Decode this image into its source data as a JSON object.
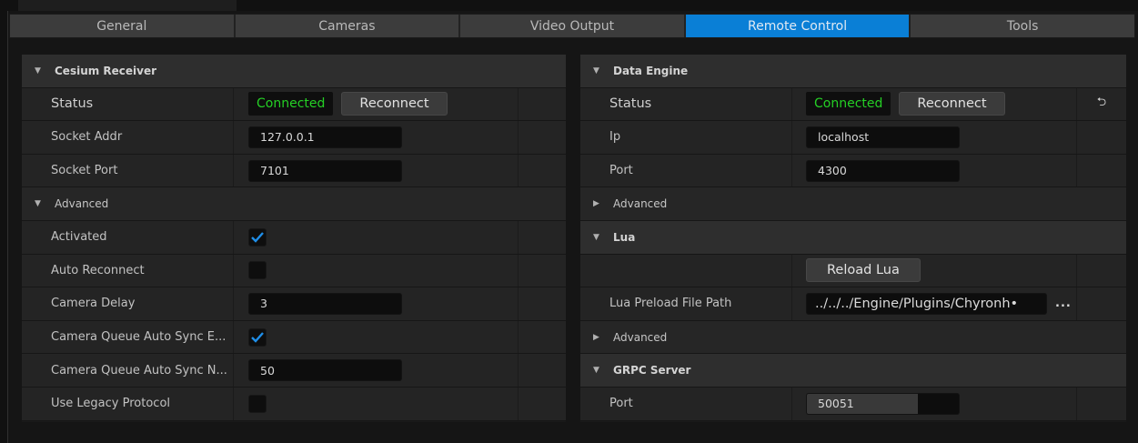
{
  "tabs": [
    {
      "label": "General",
      "active": false
    },
    {
      "label": "Cameras",
      "active": false
    },
    {
      "label": "Video Output",
      "active": false
    },
    {
      "label": "Remote Control",
      "active": true
    },
    {
      "label": "Tools",
      "active": false
    }
  ],
  "left": {
    "cesium_header": "Cesium Receiver",
    "status_label": "Status",
    "status_value": "Connected",
    "reconnect_label": "Reconnect",
    "socket_addr_label": "Socket Addr",
    "socket_addr_value": "127.0.0.1",
    "socket_port_label": "Socket Port",
    "socket_port_value": "7101",
    "advanced_label": "Advanced",
    "activated_label": "Activated",
    "activated_checked": true,
    "auto_reconnect_label": "Auto Reconnect",
    "auto_reconnect_checked": false,
    "camera_delay_label": "Camera Delay",
    "camera_delay_value": "3",
    "queue_sync_e_label": "Camera Queue Auto Sync E...",
    "queue_sync_e_checked": true,
    "queue_sync_n_label": "Camera Queue Auto Sync N...",
    "queue_sync_n_value": "50",
    "legacy_label": "Use Legacy Protocol",
    "legacy_checked": false
  },
  "right": {
    "data_engine_header": "Data Engine",
    "status_label": "Status",
    "status_value": "Connected",
    "reconnect_label": "Reconnect",
    "ip_label": "Ip",
    "ip_value": "localhost",
    "port_label": "Port",
    "port_value": "4300",
    "advanced_label": "Advanced",
    "lua_header": "Lua",
    "reload_lua_label": "Reload Lua",
    "lua_path_label": "Lua Preload File Path",
    "lua_path_value": "../../../Engine/Plugins/Chyronh•",
    "ellipsis_label": "...",
    "advanced2_label": "Advanced",
    "grpc_header": "GRPC Server",
    "grpc_port_label": "Port",
    "grpc_port_value": "50051",
    "grpc_port_fill_fraction": 0.73
  },
  "icons": {
    "expand": "triangle-down-icon",
    "collapsed": "triangle-right-icon",
    "reset": "reset-arrow-icon",
    "check": "checkmark-icon"
  },
  "colors": {
    "accent_tab": "#0a7fd6",
    "status_green": "#25d025",
    "check_blue": "#1f8ee8"
  }
}
